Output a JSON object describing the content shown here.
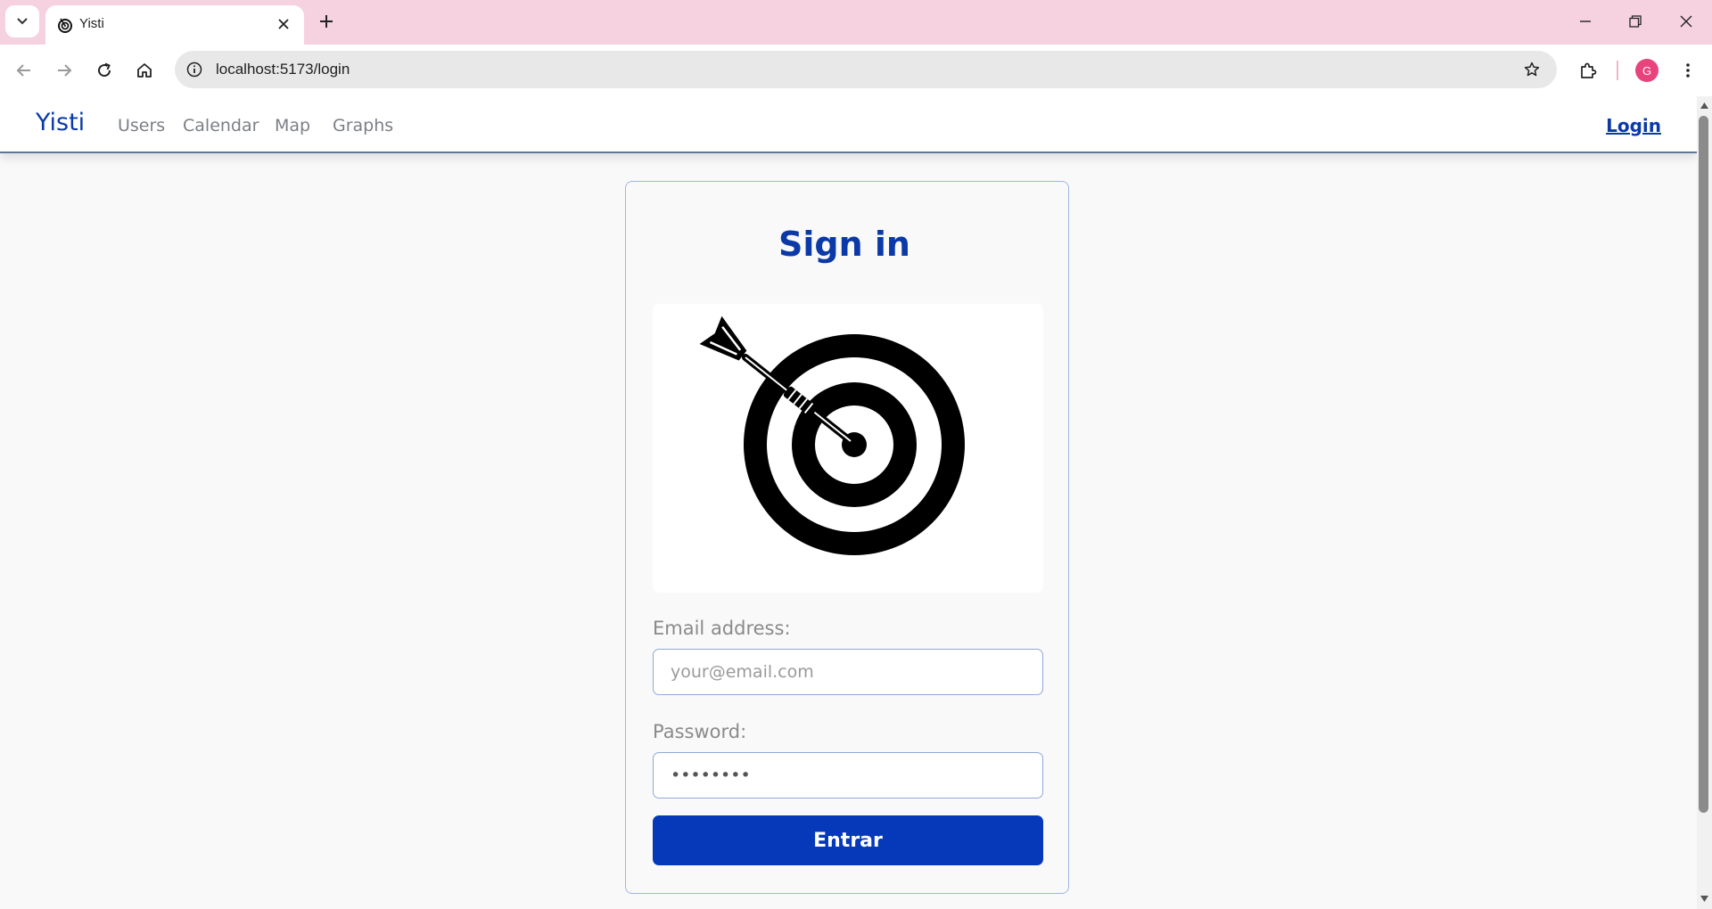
{
  "browser": {
    "tab": {
      "title": "Yisti",
      "favicon": "target-icon"
    },
    "address_bar": {
      "url": "localhost:5173/login"
    },
    "profile": {
      "initial": "G",
      "color": "#e8437c"
    },
    "tabstrip_color": "#f6d1df"
  },
  "app": {
    "brand": "Yisti",
    "nav": {
      "links": [
        "Users",
        "Calendar",
        "Map",
        "Graphs"
      ],
      "login": "Login"
    },
    "accent_color": "#0b3aa8"
  },
  "login_form": {
    "title": "Sign in",
    "illustration": "dart-target-icon",
    "email": {
      "label": "Email address:",
      "placeholder": "your@email.com",
      "value": ""
    },
    "password": {
      "label": "Password:",
      "value": "••••••••"
    },
    "submit_label": "Entrar",
    "button_color": "#0539b9"
  }
}
